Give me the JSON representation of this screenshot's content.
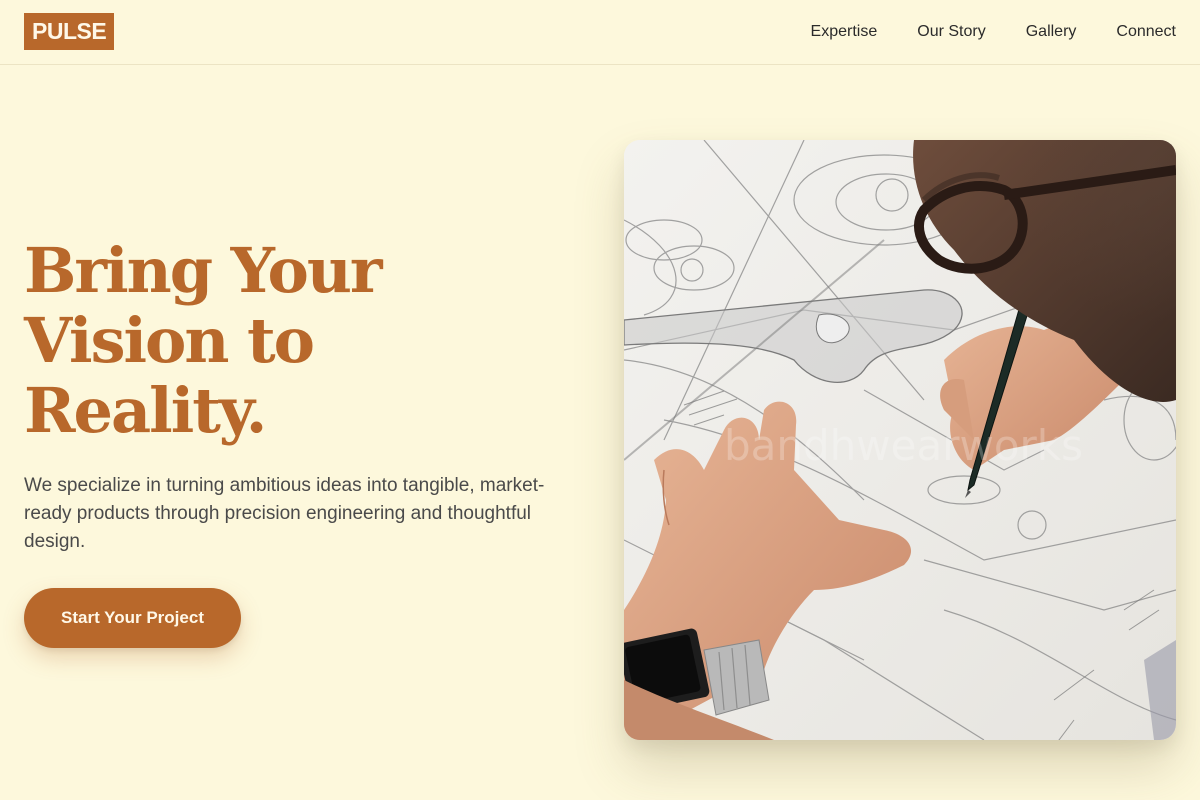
{
  "header": {
    "logo": "PULSE",
    "nav": [
      "Expertise",
      "Our Story",
      "Gallery",
      "Connect"
    ]
  },
  "hero": {
    "headline_lines": [
      "Bring Your",
      "Vision to",
      "Reality."
    ],
    "subtitle": "We specialize in turning ambitious ideas into tangible, market-ready products through precision engineering and thoughtful design.",
    "cta_label": "Start Your Project",
    "image_watermark": "bandhwearworks"
  },
  "colors": {
    "background": "#fdf8dc",
    "accent": "#b8682b",
    "text": "#3a3a3a"
  }
}
